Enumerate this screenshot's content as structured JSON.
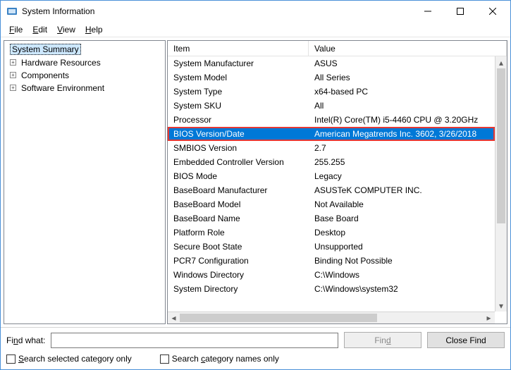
{
  "window": {
    "title": "System Information"
  },
  "menu": {
    "file": "File",
    "edit": "Edit",
    "view": "View",
    "help": "Help"
  },
  "tree": {
    "root": "System Summary",
    "children": [
      "Hardware Resources",
      "Components",
      "Software Environment"
    ]
  },
  "columns": {
    "item": "Item",
    "value": "Value"
  },
  "rows": [
    {
      "item": "System Manufacturer",
      "value": "ASUS"
    },
    {
      "item": "System Model",
      "value": "All Series"
    },
    {
      "item": "System Type",
      "value": "x64-based PC"
    },
    {
      "item": "System SKU",
      "value": "All"
    },
    {
      "item": "Processor",
      "value": "Intel(R) Core(TM) i5-4460  CPU @ 3.20GHz"
    },
    {
      "item": "BIOS Version/Date",
      "value": "American Megatrends Inc. 3602, 3/26/2018",
      "selected": true,
      "highlight": true
    },
    {
      "item": "SMBIOS Version",
      "value": "2.7"
    },
    {
      "item": "Embedded Controller Version",
      "value": "255.255"
    },
    {
      "item": "BIOS Mode",
      "value": "Legacy"
    },
    {
      "item": "BaseBoard Manufacturer",
      "value": "ASUSTeK COMPUTER INC."
    },
    {
      "item": "BaseBoard Model",
      "value": "Not Available"
    },
    {
      "item": "BaseBoard Name",
      "value": "Base Board"
    },
    {
      "item": "Platform Role",
      "value": "Desktop"
    },
    {
      "item": "Secure Boot State",
      "value": "Unsupported"
    },
    {
      "item": "PCR7 Configuration",
      "value": "Binding Not Possible"
    },
    {
      "item": "Windows Directory",
      "value": "C:\\Windows"
    },
    {
      "item": "System Directory",
      "value": "C:\\Windows\\system32"
    }
  ],
  "find": {
    "label": "Find what:",
    "value": "",
    "find_btn": "Find",
    "close_btn": "Close Find",
    "opt_selected": "Search selected category only",
    "opt_names": "Search category names only"
  }
}
